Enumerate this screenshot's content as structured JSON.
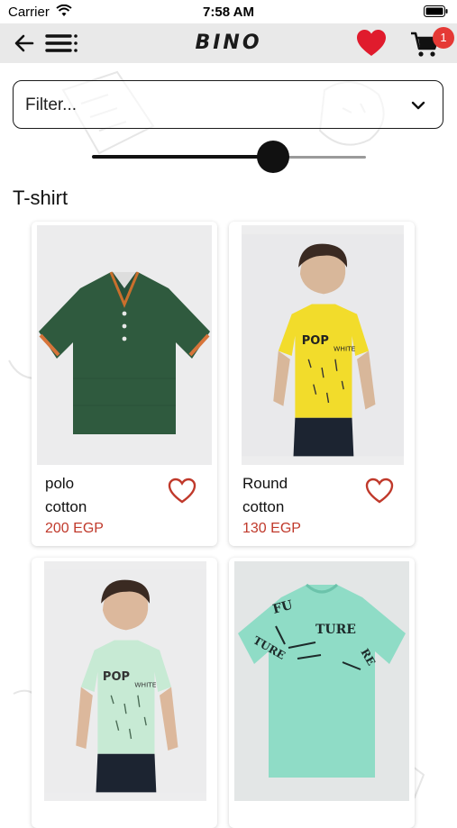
{
  "status_bar": {
    "carrier": "Carrier",
    "time": "7:58 AM"
  },
  "header": {
    "logo": "BINO",
    "cart_count": "1"
  },
  "filter": {
    "placeholder": "Filter..."
  },
  "slider": {
    "value_fraction": 0.66
  },
  "section": {
    "title": "T-shirt"
  },
  "products": [
    {
      "name": "polo",
      "material": "cotton",
      "price": "200 EGP",
      "image": "green-polo-shirt",
      "color": "#2f5a3e"
    },
    {
      "name": "Round",
      "material": "cotton",
      "price": "130 EGP",
      "image": "boy-yellow-tshirt",
      "color": "#f2dc2b"
    },
    {
      "name": "",
      "material": "",
      "price": "",
      "image": "boy-mint-tshirt",
      "color": "#c7ead4"
    },
    {
      "name": "",
      "material": "",
      "price": "",
      "image": "mint-tshirt-print",
      "color": "#8fdcc6"
    }
  ],
  "colors": {
    "accent_red": "#e01b2d",
    "price_red": "#c0392b",
    "header_bg": "#e9e9e9"
  }
}
